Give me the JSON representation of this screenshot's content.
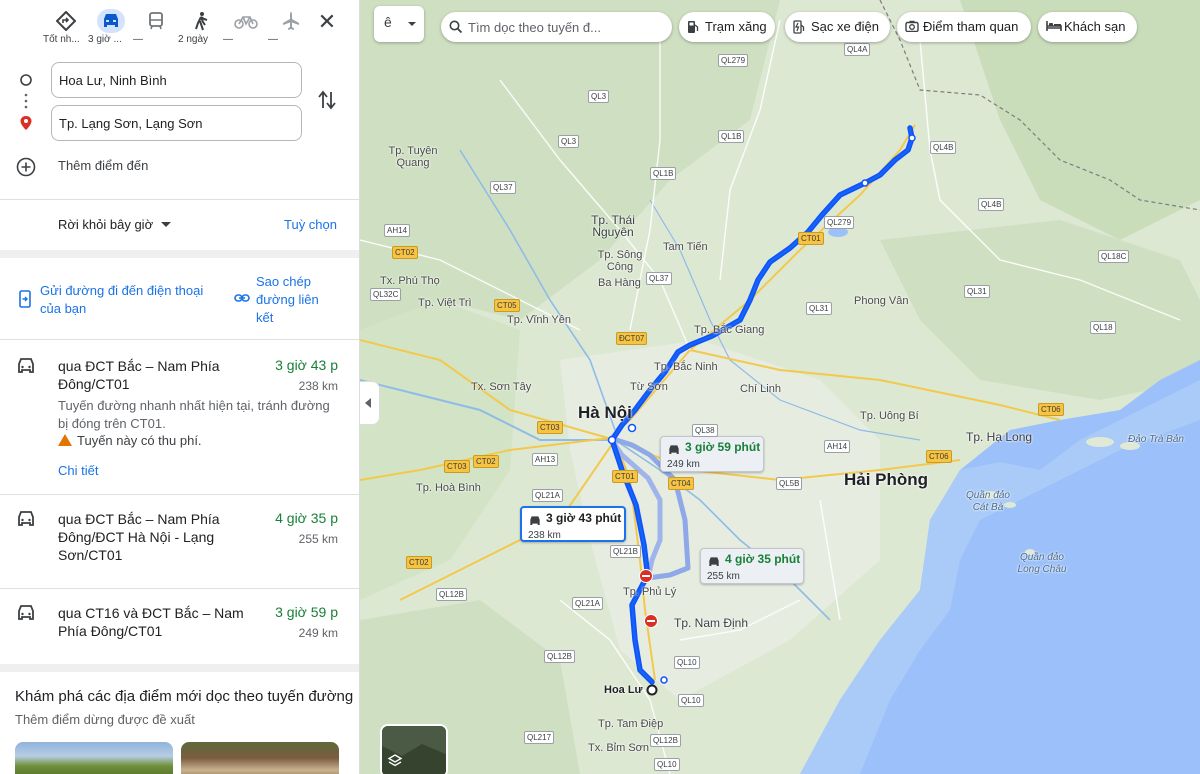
{
  "modes": [
    {
      "icon": "best-route-icon",
      "label": "Tốt nh..."
    },
    {
      "icon": "car-icon",
      "label": "3 giờ ..."
    },
    {
      "icon": "transit-icon",
      "label": "—"
    },
    {
      "icon": "walk-icon",
      "label": "2 ngày"
    },
    {
      "icon": "bike-icon",
      "label": "—"
    },
    {
      "icon": "flight-icon",
      "label": "—"
    }
  ],
  "origin": "Hoa Lư, Ninh Bình",
  "destination": "Tp. Lạng Sơn, Lạng Sơn",
  "add_stop": "Thêm điểm đến",
  "depart": "Rời khỏi bây giờ",
  "options": "Tuỳ chọn",
  "send_to_phone": "Gửi đường đi đến điện thoại của bạn",
  "copy_link": "Sao chép đường liên kết",
  "routes": [
    {
      "name": "qua ĐCT Bắc – Nam Phía Đông/CT01",
      "time": "3 giờ 43 p",
      "distance": "238 km",
      "description": "Tuyến đường nhanh nhất hiện tại, tránh đường bị đóng trên CT01.",
      "warning": "Tuyến này có thu phí.",
      "details": "Chi tiết"
    },
    {
      "name": "qua ĐCT Bắc – Nam Phía Đông/ĐCT Hà Nội - Lạng Sơn/CT01",
      "time": "4 giờ 35 p",
      "distance": "255 km"
    },
    {
      "name": "qua CT16 và ĐCT Bắc – Nam Phía Đông/CT01",
      "time": "3 giờ 59 p",
      "distance": "249 km"
    }
  ],
  "explore": {
    "title": "Khám phá các địa điểm mới dọc theo tuyến đường",
    "subtitle": "Thêm điểm dừng được đề xuất"
  },
  "map": {
    "lang": "ê",
    "search_placeholder": "Tìm dọc theo tuyến đ...",
    "chips": [
      "Trạm xăng",
      "Sạc xe điện",
      "Điểm tham quan",
      "Khách sạn"
    ],
    "callouts": [
      {
        "time": "3 giờ 59 phút",
        "distance": "249 km"
      },
      {
        "time": "3 giờ 43 phút",
        "distance": "238 km"
      },
      {
        "time": "4 giờ 35 phút",
        "distance": "255 km"
      }
    ],
    "places": {
      "hanoi": "Hà Nội",
      "haiphong": "Hải Phòng",
      "halong": "Tp. Hạ Long",
      "namdinh": "Tp. Nam Định",
      "hoalu": "Hoa Lư",
      "thainguyen": "Tp. Thái Nguyên",
      "tuyenquang": "Tp. Tuyên Quang",
      "songcong": "Tp. Sông Công",
      "tamtien": "Tam Tiến",
      "bahang": "Ba Hàng",
      "phutho": "Tx. Phú Thọ",
      "viettri": "Tp. Việt Trì",
      "vinhyen": "Tp. Vĩnh Yên",
      "bacgiang": "Tp. Bắc Giang",
      "bacninh": "Tp. Bắc Ninh",
      "tuson": "Từ Sơn",
      "sontay": "Tx. Sơn Tây",
      "chilinh": "Chí Linh",
      "phongvan": "Phong Vân",
      "uongbi": "Tp. Uông Bí",
      "hoabinh": "Tp. Hoà Bình",
      "phuly": "Tp. Phủ Lý",
      "tamdiep": "Tp. Tam Điệp",
      "bimson": "Tx. Bỉm Sơn",
      "catba": "Quần đảo Cát Bà",
      "longchau": "Quần đảo Long Châu",
      "daotraban": "Đảo Trà Bản"
    },
    "shields": [
      "QL4A",
      "QL279",
      "QL3",
      "QL1B",
      "QL3",
      "QL4B",
      "QL1B",
      "QL37",
      "QL4B",
      "QL279",
      "CT01",
      "AH14",
      "CT02",
      "QL18C",
      "QL37",
      "QL31",
      "QL32C",
      "CT05",
      "QL31",
      "QL18",
      "ĐCT07",
      "CT06",
      "QL38",
      "AH14",
      "CT03",
      "CT02",
      "CT03",
      "AH13",
      "CT01",
      "CT04",
      "QL5B",
      "CT06",
      "QL21A",
      "QL21B",
      "CT02",
      "QL12B",
      "QL21A",
      "QL12B",
      "QL10",
      "QL10",
      "QL217",
      "QL12B",
      "QL10"
    ]
  }
}
